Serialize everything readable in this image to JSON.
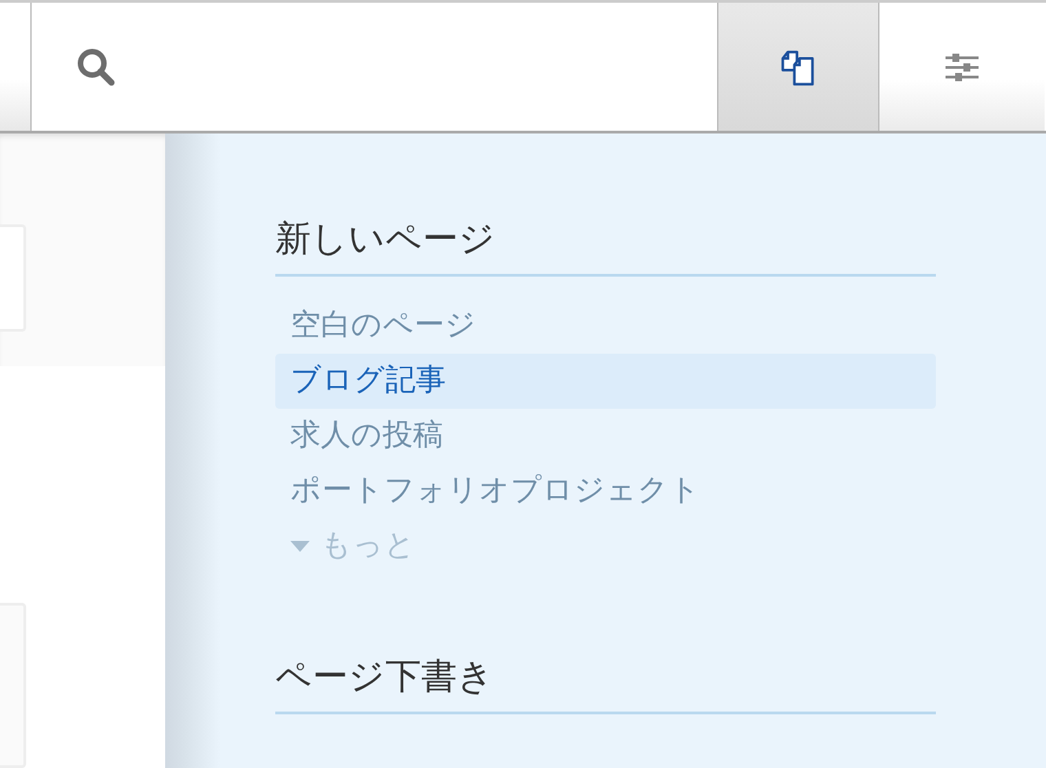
{
  "toolbar": {
    "buttons": [
      {
        "kind": "pages",
        "selected": true
      },
      {
        "kind": "settings",
        "selected": false
      }
    ]
  },
  "panel": {
    "sections": [
      {
        "title": "新しいページ",
        "items": [
          {
            "label": "空白のページ",
            "selected": false
          },
          {
            "label": "ブログ記事",
            "selected": true
          },
          {
            "label": "求人の投稿",
            "selected": false
          },
          {
            "label": "ポートフォリオプロジェクト",
            "selected": false
          }
        ],
        "more": {
          "label": "もっと",
          "expanded": false
        }
      },
      {
        "title": "ページ下書き"
      }
    ]
  }
}
